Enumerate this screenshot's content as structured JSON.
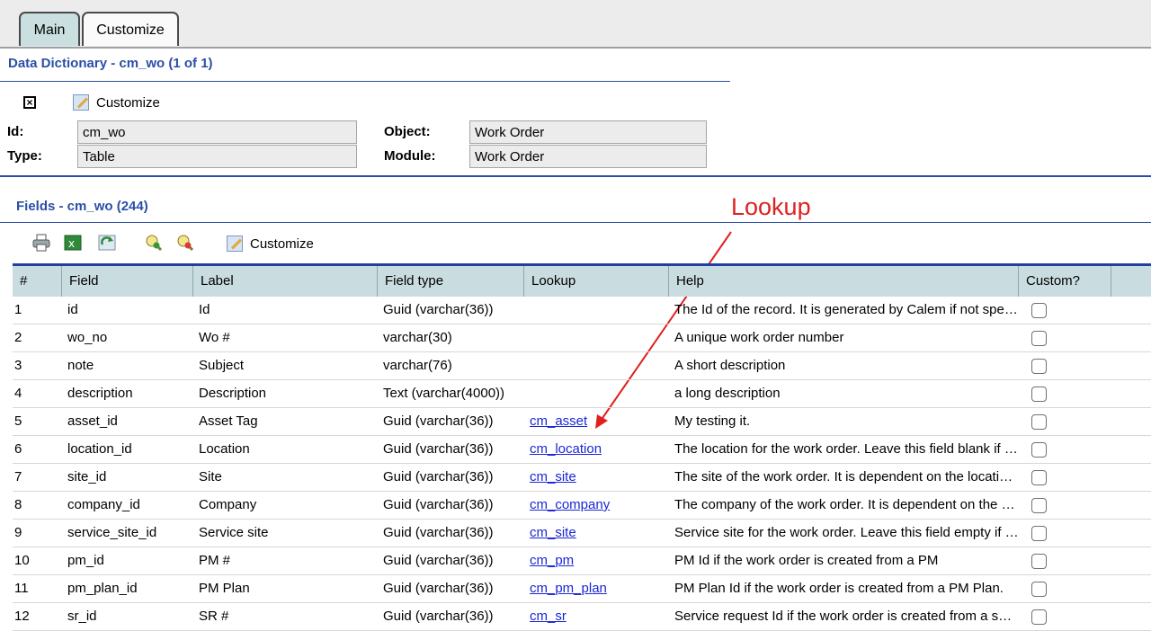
{
  "tabs": {
    "main": "Main",
    "customize": "Customize"
  },
  "dictionary": {
    "title": "Data Dictionary - cm_wo (1 of 1)",
    "customize_label": "Customize",
    "id_label": "Id:",
    "id_value": "cm_wo",
    "type_label": "Type:",
    "type_value": "Table",
    "object_label": "Object:",
    "object_value": "Work Order",
    "module_label": "Module:",
    "module_value": "Work Order"
  },
  "fields": {
    "title": "Fields - cm_wo (244)",
    "customize_label": "Customize",
    "annotation": "Lookup",
    "columns": [
      "#",
      "Field",
      "Label",
      "Field type",
      "Lookup",
      "Help",
      "Custom?"
    ],
    "rows": [
      {
        "n": "1",
        "field": "id",
        "label": "Id",
        "type": "Guid (varchar(36))",
        "lookup": "",
        "help": "The Id of the record. It is generated by Calem if not specified."
      },
      {
        "n": "2",
        "field": "wo_no",
        "label": "Wo #",
        "type": "varchar(30)",
        "lookup": "",
        "help": "A unique work order number"
      },
      {
        "n": "3",
        "field": "note",
        "label": "Subject",
        "type": "varchar(76)",
        "lookup": "",
        "help": "A short description"
      },
      {
        "n": "4",
        "field": "description",
        "label": "Description",
        "type": "Text (varchar(4000))",
        "lookup": "",
        "help": "a long description"
      },
      {
        "n": "5",
        "field": "asset_id",
        "label": "Asset Tag",
        "type": "Guid (varchar(36))",
        "lookup": "cm_asset",
        "help": "My testing it."
      },
      {
        "n": "6",
        "field": "location_id",
        "label": "Location",
        "type": "Guid (varchar(36))",
        "lookup": "cm_location",
        "help": "The location for the work order. Leave this field blank if not applicable."
      },
      {
        "n": "7",
        "field": "site_id",
        "label": "Site",
        "type": "Guid (varchar(36))",
        "lookup": "cm_site",
        "help": "The site of the work order. It is dependent on the location selected."
      },
      {
        "n": "8",
        "field": "company_id",
        "label": "Company",
        "type": "Guid (varchar(36))",
        "lookup": "cm_company",
        "help": "The company of the work order. It is dependent on the site selected."
      },
      {
        "n": "9",
        "field": "service_site_id",
        "label": "Service site",
        "type": "Guid (varchar(36))",
        "lookup": "cm_site",
        "help": "Service site for the work order. Leave this field empty if not applicable."
      },
      {
        "n": "10",
        "field": "pm_id",
        "label": "PM #",
        "type": "Guid (varchar(36))",
        "lookup": "cm_pm",
        "help": "PM Id if the work order is created from a PM"
      },
      {
        "n": "11",
        "field": "pm_plan_id",
        "label": "PM Plan",
        "type": "Guid (varchar(36))",
        "lookup": "cm_pm_plan",
        "help": "PM Plan Id if the work order is created from a PM Plan."
      },
      {
        "n": "12",
        "field": "sr_id",
        "label": "SR #",
        "type": "Guid (varchar(36))",
        "lookup": "cm_sr",
        "help": "Service request Id if the work order is created from a service request."
      }
    ]
  },
  "toolbar_icons": [
    "print-icon",
    "export-excel-icon",
    "refresh-icon",
    "zoom-in-icon",
    "zoom-out-icon",
    "customize-icon"
  ],
  "colors": {
    "accent": "#2b4fa6",
    "header_bg": "#c9dde0",
    "annotation": "#e02020",
    "link": "#1a27d6"
  }
}
